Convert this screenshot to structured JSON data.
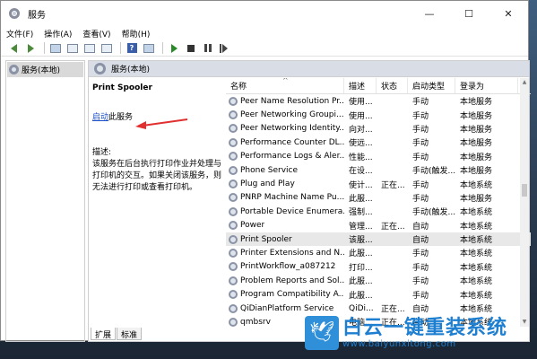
{
  "window": {
    "title": "服务",
    "controls": {
      "minimize": "—",
      "maximize": "☐",
      "close": "✕"
    }
  },
  "menu": [
    "文件(F)",
    "操作(A)",
    "查看(V)",
    "帮助(H)"
  ],
  "toolbar_icons": [
    "back-icon",
    "forward-icon",
    "console-tree-icon",
    "properties-icon",
    "refresh-icon",
    "export-icon",
    "help-icon",
    "show-tree-icon",
    "start-service-icon",
    "stop-service-icon",
    "pause-service-icon",
    "restart-service-icon"
  ],
  "tree": {
    "item": "服务(本地)"
  },
  "main": {
    "header": "服务(本地)",
    "detail": {
      "name": "Print Spooler",
      "action_link": "启动",
      "action_rest": "此服务",
      "desc_label": "描述:",
      "desc": "该服务在后台执行打印作业并处理与打印机的交互。如果关闭该服务，则无法进行打印或查看打印机。"
    },
    "columns": [
      "名称",
      "描述",
      "状态",
      "启动类型",
      "登录为"
    ],
    "rows": [
      {
        "name": "Peer Name Resolution Pr...",
        "desc": "使用...",
        "state": "",
        "start": "手动",
        "logon": "本地服务"
      },
      {
        "name": "Peer Networking Groupi...",
        "desc": "使用...",
        "state": "",
        "start": "手动",
        "logon": "本地服务"
      },
      {
        "name": "Peer Networking Identity...",
        "desc": "向对...",
        "state": "",
        "start": "手动",
        "logon": "本地服务"
      },
      {
        "name": "Performance Counter DL...",
        "desc": "使远...",
        "state": "",
        "start": "手动",
        "logon": "本地服务"
      },
      {
        "name": "Performance Logs & Aler...",
        "desc": "性能...",
        "state": "",
        "start": "手动",
        "logon": "本地服务"
      },
      {
        "name": "Phone Service",
        "desc": "在设...",
        "state": "",
        "start": "手动(触发...",
        "logon": "本地服务"
      },
      {
        "name": "Plug and Play",
        "desc": "使计...",
        "state": "正在...",
        "start": "手动",
        "logon": "本地系统"
      },
      {
        "name": "PNRP Machine Name Pu...",
        "desc": "此服...",
        "state": "",
        "start": "手动",
        "logon": "本地服务"
      },
      {
        "name": "Portable Device Enumera...",
        "desc": "强制...",
        "state": "",
        "start": "手动(触发...",
        "logon": "本地系统"
      },
      {
        "name": "Power",
        "desc": "管理...",
        "state": "正在...",
        "start": "自动",
        "logon": "本地系统"
      },
      {
        "name": "Print Spooler",
        "desc": "该服...",
        "state": "",
        "start": "自动",
        "logon": "本地系统"
      },
      {
        "name": "Printer Extensions and N...",
        "desc": "此服...",
        "state": "",
        "start": "手动",
        "logon": "本地系统"
      },
      {
        "name": "PrintWorkflow_a087212",
        "desc": "打印...",
        "state": "",
        "start": "手动",
        "logon": "本地系统"
      },
      {
        "name": "Problem Reports and Sol...",
        "desc": "此服...",
        "state": "",
        "start": "手动",
        "logon": "本地系统"
      },
      {
        "name": "Program Compatibility A...",
        "desc": "此服...",
        "state": "",
        "start": "手动",
        "logon": "本地系统"
      },
      {
        "name": "QiDianPlatform Service",
        "desc": "QiDi...",
        "state": "正在...",
        "start": "自动",
        "logon": "本地系统"
      },
      {
        "name": "qmbsrv",
        "desc": "电脑...",
        "state": "正在...",
        "start": "自动",
        "logon": "本地系统"
      }
    ],
    "selected_row": "Print Spooler",
    "tabs": [
      "扩展",
      "标准"
    ]
  },
  "watermark": {
    "brand": "白云一键重装系统",
    "url": "www.baiyunxitong.com"
  },
  "colors": {
    "link": "#1a4fc8",
    "arrow": "#e03030",
    "header_bg": "#d9dee6",
    "watermark": "#1e7fd0"
  }
}
